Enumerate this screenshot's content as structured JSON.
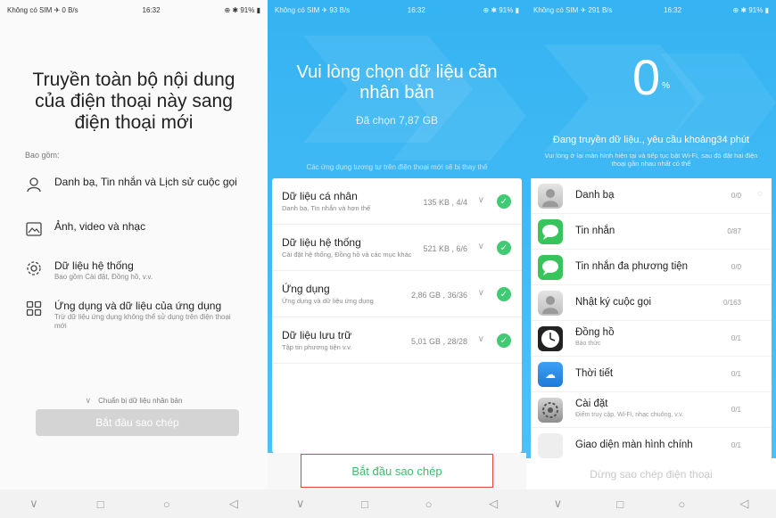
{
  "panel1": {
    "status": {
      "network": "Không có SIM ✈ 0 B/s",
      "time": "16:32",
      "right": "⊕ ✱ 91% ▮"
    },
    "title_lines": [
      "Truyền toàn bộ nội dung",
      "của điện thoại này sang",
      "điện thoại mới"
    ],
    "include_label": "Bao gồm:",
    "items": [
      {
        "title": "Danh bạ, Tin nhắn và Lịch sử cuộc gọi",
        "subtitle": ""
      },
      {
        "title": "Ảnh, video và nhạc",
        "subtitle": ""
      },
      {
        "title": "Dữ liệu hệ thống",
        "subtitle": "Bao gồm Cài đặt, Đồng hồ, v.v."
      },
      {
        "title": "Ứng dụng và dữ liệu của ứng dụng",
        "subtitle": "Trừ dữ liệu ứng dụng không thể sử dụng trên điện thoại mới"
      }
    ],
    "prepare_text": "Chuẩn bị dữ liệu nhân bản",
    "start_button": "Bắt đầu sao chép"
  },
  "panel2": {
    "status": {
      "network": "Không có SIM ✈ 93 B/s",
      "time": "16:32",
      "right": "⊕ ✱ 91% ▮"
    },
    "title_lines": [
      "Vui lòng chọn dữ liệu cần",
      "nhân bản"
    ],
    "selected": "Đã chọn 7,87 GB",
    "note": "Các ứng dụng tương tự trên điện thoại mới sẽ bị thay thế",
    "rows": [
      {
        "name": "Dữ liệu cá nhân",
        "desc": "Danh bạ, Tin nhắn và hơn thế",
        "size": "135 KB , 4/4"
      },
      {
        "name": "Dữ liệu hệ thống",
        "desc": "Cài đặt hệ thống, Đồng hồ và các mục khác",
        "size": "521 KB , 6/6"
      },
      {
        "name": "Ứng dụng",
        "desc": "Ứng dụng và dữ liệu ứng dụng",
        "size": "2,86 GB , 36/36"
      },
      {
        "name": "Dữ liệu lưu trữ",
        "desc": "Tập tin phương tiện v.v.",
        "size": "5,01 GB , 28/28"
      }
    ],
    "start_button": "Bắt đầu sao chép"
  },
  "panel3": {
    "status": {
      "network": "Không có SIM ✈ 291 B/s",
      "time": "16:32",
      "right": "⊕ ✱ 91% ▮"
    },
    "percent": "0",
    "percent_sign": "%",
    "progress_fraction": 0,
    "status_text": "Đang truyền dữ liệu., yêu cầu khoảng34 phút",
    "note": "Vui lòng ở lại màn hình hiện tại và tiếp tục bật Wi-Fi, sau đó đặt hai điện thoại gần nhau nhất có thể",
    "rows": [
      {
        "name": "Danh bạ",
        "desc": "",
        "count": "0/0",
        "icon": "contacts-icon"
      },
      {
        "name": "Tin nhắn",
        "desc": "",
        "count": "0/87",
        "icon": "messages-icon"
      },
      {
        "name": "Tin nhắn đa phương tiện",
        "desc": "",
        "count": "0/0",
        "icon": "mms-icon"
      },
      {
        "name": "Nhật ký cuộc gọi",
        "desc": "",
        "count": "0/163",
        "icon": "call-log-icon"
      },
      {
        "name": "Đồng hồ",
        "desc": "Báo thức",
        "count": "0/1",
        "icon": "clock-icon"
      },
      {
        "name": "Thời tiết",
        "desc": "",
        "count": "0/1",
        "icon": "weather-icon"
      },
      {
        "name": "Cài đặt",
        "desc": "Điểm truy cập, Wi-Fi, nhạc chuông, v.v.",
        "count": "0/1",
        "icon": "settings-icon"
      },
      {
        "name": "Giao diện màn hình chính",
        "desc": "",
        "count": "0/1",
        "icon": "home-screen-icon"
      }
    ],
    "stop_button": "Dừng sao chép điện thoại"
  },
  "navbar": {
    "back": "◁",
    "home": "○",
    "recent": "□",
    "down": "∨"
  },
  "colors": {
    "accent_blue": "#35b3f2",
    "check_green": "#3fca73",
    "highlight_red": "#e8413c",
    "button_text_green": "#3fbb6a"
  }
}
